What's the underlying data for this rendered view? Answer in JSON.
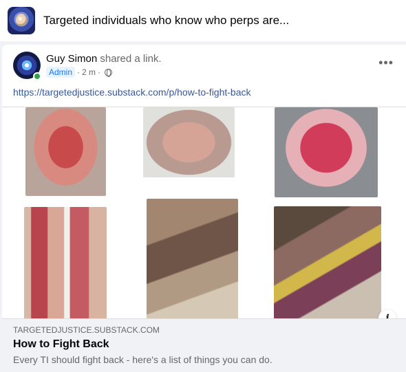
{
  "group": {
    "title": "Targeted individuals who know who perps are..."
  },
  "post": {
    "author_name": "Guy Simon",
    "action_text": " shared a link.",
    "role_badge": "Admin",
    "separator": "·",
    "timestamp": "2 m",
    "privacy_icon": "globe-icon",
    "more_label": "•••",
    "link_url": "https://targetedjustice.substack.com/p/how-to-fight-back"
  },
  "link_preview": {
    "domain": "TARGETEDJUSTICE.SUBSTACK.COM",
    "title": "How to Fight Back",
    "description": "Every TI should fight back - here's a list of things you can do.",
    "info_label": "i"
  },
  "colors": {
    "link": "#385898",
    "admin_badge_bg": "#e7f3ff",
    "admin_badge_text": "#1877f2",
    "online": "#31a24c",
    "secondary_text": "#65676b"
  }
}
